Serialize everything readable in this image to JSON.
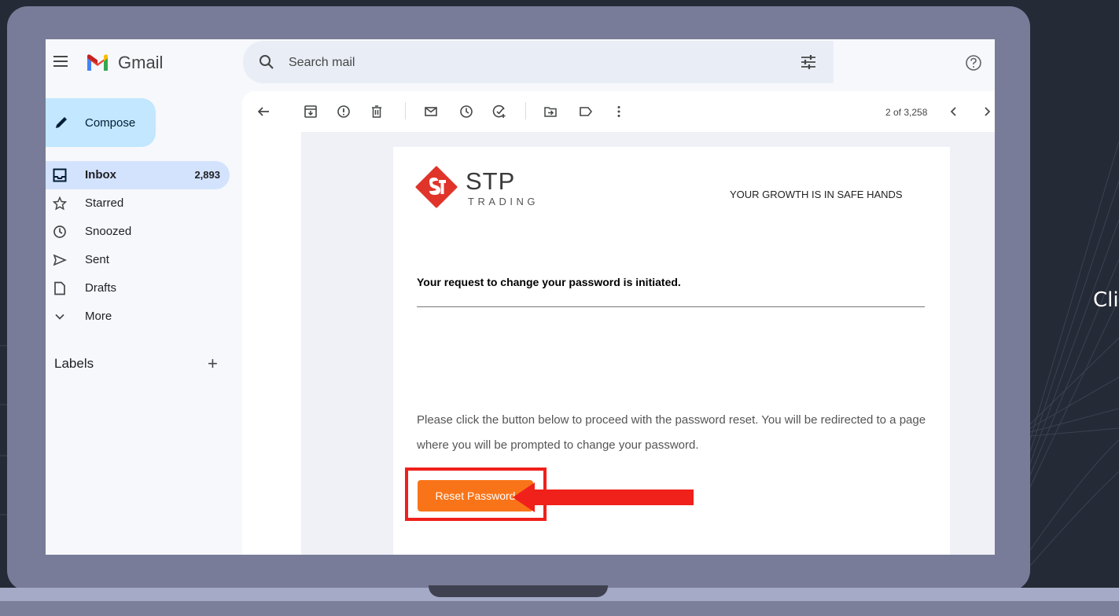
{
  "side_caption": "Cli",
  "gmail": {
    "brand": "Gmail",
    "search": {
      "placeholder": "Search mail"
    },
    "compose_label": "Compose",
    "nav": [
      {
        "label": "Inbox",
        "count": "2,893",
        "icon": "inbox-icon"
      },
      {
        "label": "Starred",
        "count": "",
        "icon": "star-icon"
      },
      {
        "label": "Snoozed",
        "count": "",
        "icon": "clock-icon"
      },
      {
        "label": "Sent",
        "count": "",
        "icon": "send-icon"
      },
      {
        "label": "Drafts",
        "count": "",
        "icon": "draft-icon"
      },
      {
        "label": "More",
        "count": "",
        "icon": "chevron-down-icon"
      }
    ],
    "labels_heading": "Labels",
    "labels_add": "+",
    "toolbar_icons": [
      "back-arrow-icon",
      "archive-icon",
      "report-spam-icon",
      "delete-icon",
      "mark-unread-icon",
      "snooze-icon",
      "add-task-icon",
      "move-to-icon",
      "label-icon",
      "more-vert-icon"
    ],
    "pager": "2 of 3,258"
  },
  "email": {
    "brand_name": "STP",
    "brand_sub": "TRADING",
    "tagline": "YOUR GROWTH IS IN SAFE HANDS",
    "headline": "Your request to change your password is initiated.",
    "body": "Please click the button below to proceed with the password reset. You will be redirected to a page where you will be prompted to change your password.",
    "button_label": "Reset Password"
  },
  "colors": {
    "background": "#252a37",
    "laptop_frame": "#787c98",
    "button": "#f97418",
    "highlight": "#f0201a",
    "stp_red": "#e0342a",
    "inbox_active": "#d3e3fd",
    "compose_bg": "#c2e7ff"
  }
}
